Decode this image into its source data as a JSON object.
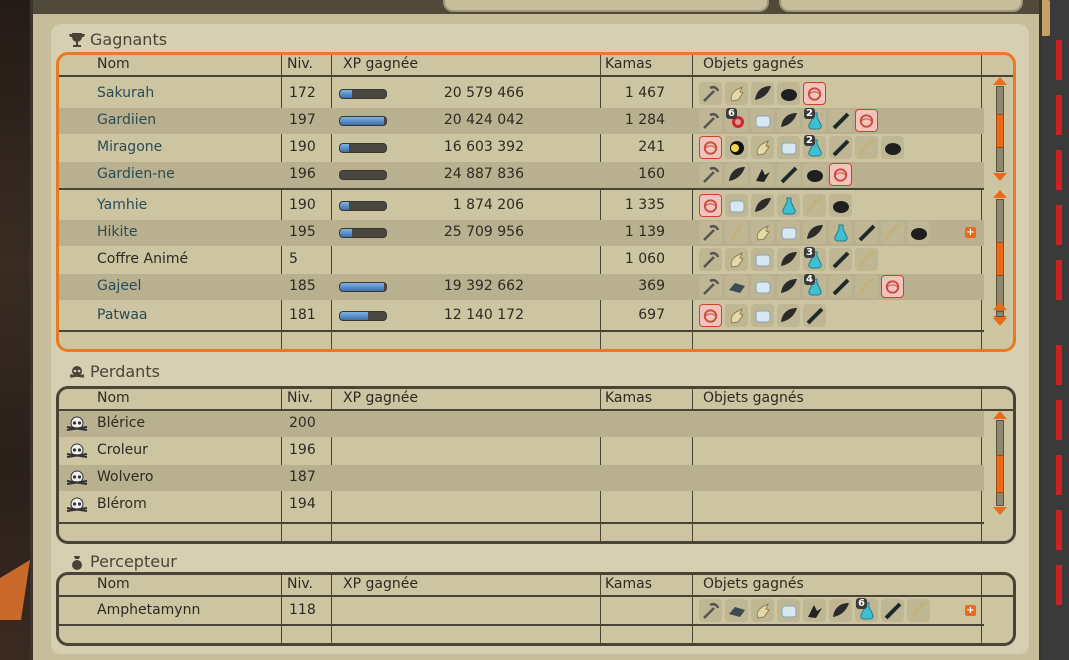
{
  "sections": {
    "winners": {
      "title": "Gagnants"
    },
    "losers": {
      "title": "Perdants"
    },
    "collector": {
      "title": "Percepteur"
    }
  },
  "columns": {
    "name": "Nom",
    "level": "Niv.",
    "xp": "XP gagnée",
    "kamas": "Kamas",
    "items": "Objets gagnés"
  },
  "winners": [
    {
      "name": "Sakurah",
      "level": "172",
      "xp": "20 579 466",
      "xp_progress": 0.25,
      "kamas": "1 467",
      "items": [
        "pickaxe-icon",
        "hand-icon",
        "wing-icon",
        "shell-icon",
        "scroll-icon"
      ],
      "qty": {}
    },
    {
      "name": "Gardiien",
      "level": "197",
      "xp": "20 424 042",
      "xp_progress": 0.95,
      "kamas": "1 284",
      "items": [
        "pickaxe-icon",
        "gem-icon",
        "cloth-icon",
        "wing-icon",
        "potion-icon",
        "feather-icon",
        "scroll-icon"
      ],
      "qty": {
        "1": "6",
        "4": "2"
      }
    },
    {
      "name": "Miragone",
      "level": "190",
      "xp": "16 603 392",
      "xp_progress": 0.2,
      "kamas": "241",
      "items": [
        "scroll-icon",
        "orb-icon",
        "hand-icon",
        "cloth-icon",
        "potion-icon",
        "feather-icon",
        "horn-icon",
        "shell-icon"
      ],
      "qty": {
        "4": "2"
      }
    },
    {
      "name": "Gardien-ne",
      "level": "196",
      "xp": "24 887 836",
      "xp_progress": 0.0,
      "kamas": "160",
      "items": [
        "pickaxe-icon",
        "wing-icon",
        "claw-icon",
        "feather-icon",
        "shell-icon",
        "scroll-icon"
      ],
      "qty": {}
    },
    {
      "name": "Yamhie",
      "level": "190",
      "xp": "1 874 206",
      "xp_progress": 0.2,
      "kamas": "1 335",
      "items": [
        "scroll-icon",
        "cloth-icon",
        "wing-icon",
        "potion-icon",
        "horn-icon",
        "shell-icon"
      ],
      "qty": {}
    },
    {
      "name": "Hikite",
      "level": "195",
      "xp": "25 709 956",
      "xp_progress": 0.25,
      "kamas": "1 139",
      "items": [
        "pickaxe-icon",
        "stick-icon",
        "hand-icon",
        "cloth-icon",
        "wing-icon",
        "potion-icon",
        "feather-icon",
        "horn-icon",
        "shell-icon"
      ],
      "qty": {},
      "more": "+"
    },
    {
      "name": "Coffre Animé",
      "level": "5",
      "xp": "",
      "xp_progress": null,
      "kamas": "1 060",
      "items": [
        "pickaxe-icon",
        "hand-icon",
        "cloth-icon",
        "wing-icon",
        "potion-icon",
        "feather-icon",
        "horn-icon"
      ],
      "qty": {
        "4": "3"
      },
      "plain": true
    },
    {
      "name": "Gajeel",
      "level": "185",
      "xp": "19 392 662",
      "xp_progress": 0.95,
      "kamas": "369",
      "items": [
        "pickaxe-icon",
        "stone-icon",
        "cloth-icon",
        "wing-icon",
        "potion-icon",
        "feather-icon",
        "horn-icon",
        "scroll-icon"
      ],
      "qty": {
        "4": "4"
      }
    },
    {
      "name": "Patwaa",
      "level": "181",
      "xp": "12 140 172",
      "xp_progress": 0.6,
      "kamas": "697",
      "items": [
        "scroll-icon",
        "hand-icon",
        "cloth-icon",
        "wing-icon",
        "feather-icon"
      ],
      "qty": {}
    }
  ],
  "losers": [
    {
      "name": "Blérice",
      "level": "200"
    },
    {
      "name": "Croleur",
      "level": "196"
    },
    {
      "name": "Wolvero",
      "level": "187"
    },
    {
      "name": "Blérom",
      "level": "194"
    }
  ],
  "collector": [
    {
      "name": "Amphetamynn",
      "level": "118",
      "items": [
        "pickaxe-icon",
        "stone-icon",
        "hand-icon",
        "cloth-icon",
        "claw-icon",
        "wing-icon",
        "potion-icon",
        "feather-icon",
        "horn-icon"
      ],
      "qty": {
        "6": "6"
      },
      "more": "+"
    }
  ],
  "colors": {
    "accent": "#e77a22",
    "link": "#2a4b55",
    "panel": "#d6cfb1"
  }
}
